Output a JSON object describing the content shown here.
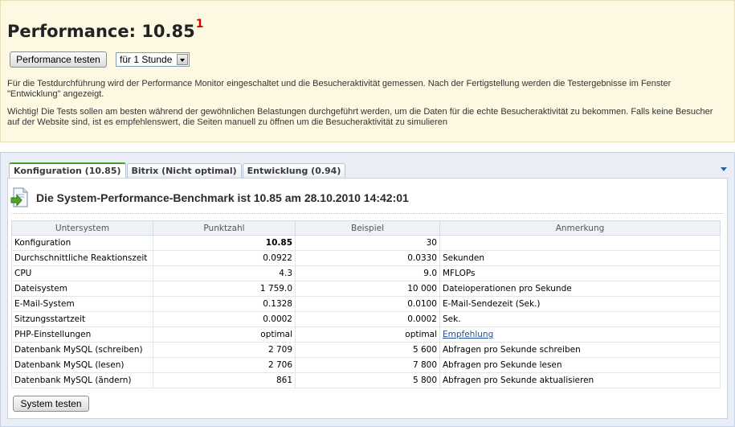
{
  "header": {
    "title": "Performance: 10.85",
    "footnote": "1",
    "test_button": "Performance testen",
    "duration_select": "für 1 Stunde",
    "info1": "Für die Testdurchführung wird der Performance Monitor eingeschaltet und die Besucheraktivität gemessen. Nach der Fertigstellung werden die Testergebnisse im Fenster \"Entwicklung\" angezeigt.",
    "info2": "Wichtig! Die Tests sollen am besten während der gewöhnlichen Belastungen durchgeführt werden, um die Daten für die echte Besucheraktivität zu bekommen. Falls keine Besucher auf der Website sind, ist es empfehlenswert, die Seiten manuell zu öffnen um die Besucheraktivität zu simulieren"
  },
  "tabs": [
    {
      "label": "Konfiguration (10.85)"
    },
    {
      "label": "Bitrix (Nicht optimal)"
    },
    {
      "label": "Entwicklung (0.94)"
    }
  ],
  "benchmark_title": "Die System-Performance-Benchmark ist 10.85 am 28.10.2010 14:42:01",
  "table": {
    "headers": [
      "Untersystem",
      "Punktzahl",
      "Beispiel",
      "Anmerkung"
    ],
    "rows": [
      [
        "Konfiguration",
        "10.85",
        "30",
        ""
      ],
      [
        "Durchschnittliche Reaktionszeit",
        "0.0922",
        "0.0330",
        "Sekunden"
      ],
      [
        "CPU",
        "4.3",
        "9.0",
        "MFLOPs"
      ],
      [
        "Dateisystem",
        "1 759.0",
        "10 000",
        "Dateioperationen pro Sekunde"
      ],
      [
        "E-Mail-System",
        "0.1328",
        "0.0100",
        "E-Mail-Sendezeit (Sek.)"
      ],
      [
        "Sitzungsstartzeit",
        "0.0002",
        "0.0002",
        "Sek."
      ],
      [
        "PHP-Einstellungen",
        "optimal",
        "optimal",
        "Empfehlung"
      ],
      [
        "Datenbank MySQL (schreiben)",
        "2 709",
        "5 600",
        "Abfragen pro Sekunde schreiben"
      ],
      [
        "Datenbank MySQL (lesen)",
        "2 706",
        "7 800",
        "Abfragen pro Sekunde lesen"
      ],
      [
        "Datenbank MySQL (ändern)",
        "861",
        "5 800",
        "Abfragen pro Sekunde aktualisieren"
      ]
    ]
  },
  "system_test_button": "System testen",
  "colors": {
    "info_bg": "#fdf8e1",
    "panel_bg": "#e9eef6",
    "active_tab_accent": "#4e9a2a",
    "footnote": "#dd0000",
    "link": "#1f4f9e"
  }
}
